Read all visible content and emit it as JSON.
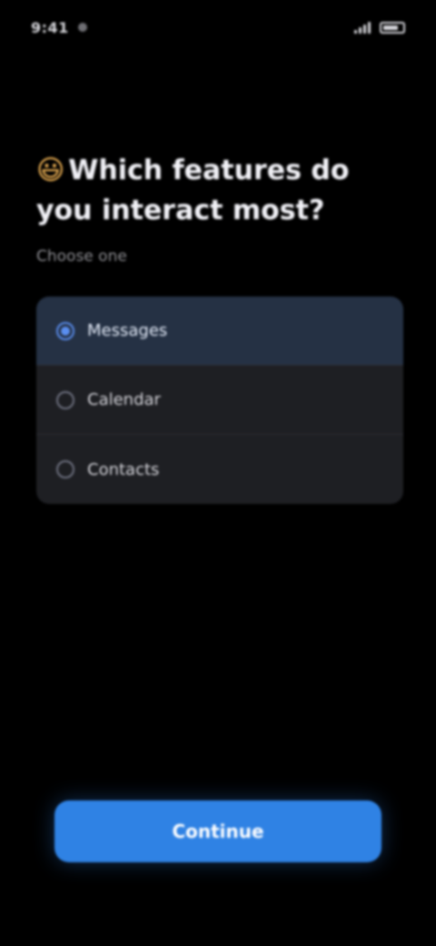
{
  "status_bar": {
    "time": "9:41"
  },
  "question": {
    "emoji": "😃",
    "title": "Which features do you interact most?",
    "subtitle": "Choose one"
  },
  "options": [
    {
      "label": "Messages",
      "selected": true
    },
    {
      "label": "Calendar",
      "selected": false
    },
    {
      "label": "Contacts",
      "selected": false
    }
  ],
  "cta": {
    "label": "Continue"
  },
  "colors": {
    "background": "#000000",
    "option_bg": "#1e1f23",
    "option_selected_bg": "#253144",
    "accent": "#2f82e4"
  }
}
